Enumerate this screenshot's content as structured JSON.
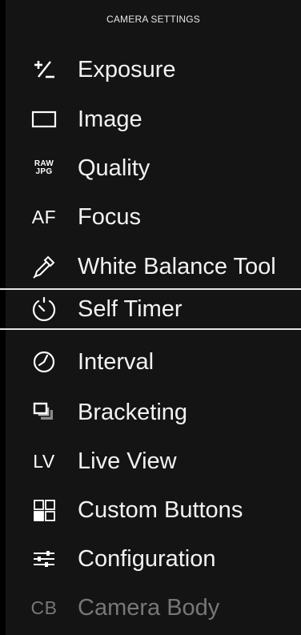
{
  "header": {
    "title": "CAMERA SETTINGS"
  },
  "menu": {
    "items": [
      {
        "label": "Exposure",
        "icon": "exposure-compensation-icon",
        "icon_text": ""
      },
      {
        "label": "Image",
        "icon": "image-frame-icon",
        "icon_text": ""
      },
      {
        "label": "Quality",
        "icon": "raw-jpg-icon",
        "icon_text_1": "RAW",
        "icon_text_2": "JPG"
      },
      {
        "label": "Focus",
        "icon": "af-icon",
        "icon_text": "AF"
      },
      {
        "label": "White Balance Tool",
        "icon": "eyedropper-icon",
        "icon_text": ""
      },
      {
        "label": "Self Timer",
        "icon": "self-timer-icon",
        "icon_text": "",
        "selected": true
      },
      {
        "label": "Interval",
        "icon": "interval-clock-icon",
        "icon_text": ""
      },
      {
        "label": "Bracketing",
        "icon": "bracketing-icon",
        "icon_text": ""
      },
      {
        "label": "Live View",
        "icon": "lv-icon",
        "icon_text": "LV"
      },
      {
        "label": "Custom Buttons",
        "icon": "custom-buttons-icon",
        "icon_text": ""
      },
      {
        "label": "Configuration",
        "icon": "sliders-icon",
        "icon_text": ""
      },
      {
        "label": "Camera Body",
        "icon": "cb-icon",
        "icon_text": "CB",
        "disabled": true
      }
    ]
  },
  "colors": {
    "background": "#141414",
    "text": "#f2f2f2",
    "disabled_text": "#777777",
    "selection_line": "#e6e6e6"
  }
}
